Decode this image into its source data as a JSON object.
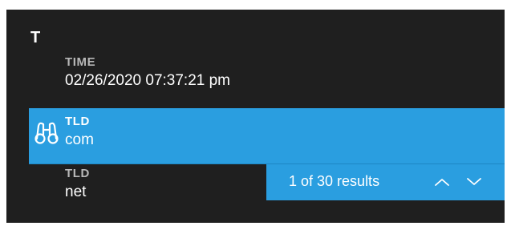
{
  "group": {
    "letter": "T"
  },
  "rows": [
    {
      "label": "TIME",
      "value": "02/26/2020 07:37:21 pm"
    },
    {
      "label": "TLD",
      "value": "com",
      "highlighted": true
    },
    {
      "label": "TLD",
      "value": "net"
    }
  ],
  "search": {
    "result_text": "1 of 30 results",
    "prev_icon": "chevron-up-icon",
    "next_icon": "chevron-down-icon"
  },
  "colors": {
    "background": "#1f1f1f",
    "highlight": "#2a9ee0",
    "label": "#b8b8b8",
    "text": "#ffffff"
  }
}
